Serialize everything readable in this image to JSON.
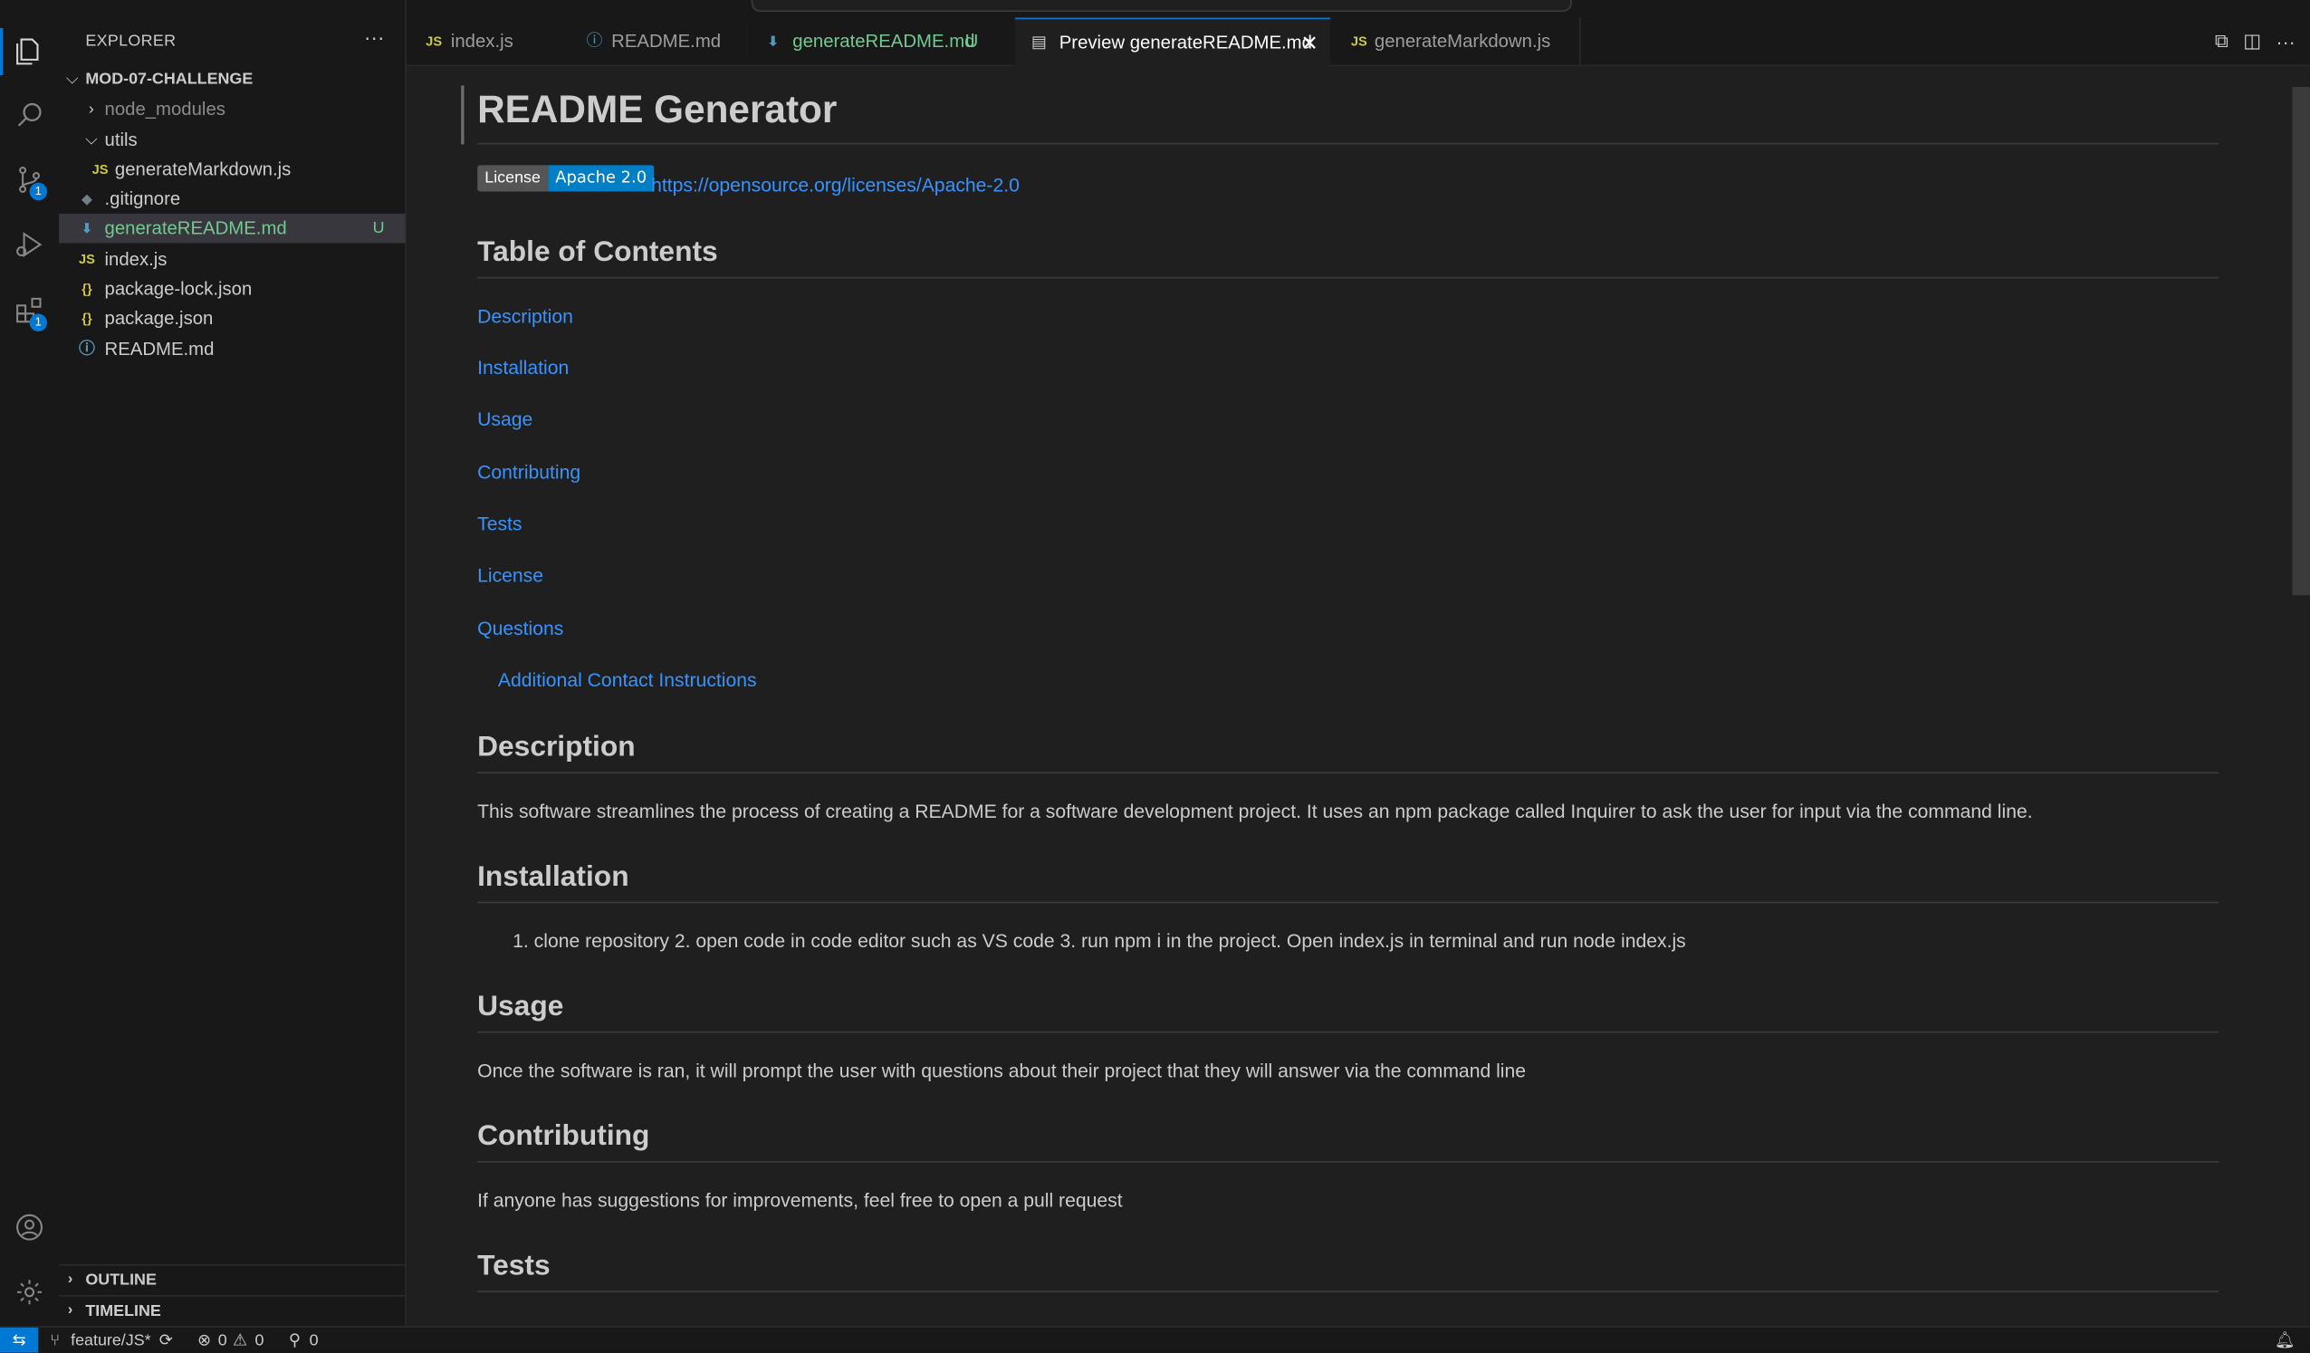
{
  "activity_bar": {
    "source_control_badge": "1",
    "extensions_badge": "1"
  },
  "sidebar": {
    "title": "EXPLORER",
    "folder": "MOD-07-CHALLENGE",
    "items": [
      {
        "label": "node_modules",
        "icon": "chevron-right-icon"
      },
      {
        "label": "utils",
        "icon": "chevron-down-icon"
      },
      {
        "label": "generateMarkdown.js",
        "icon": "js-file-icon"
      },
      {
        "label": ".gitignore",
        "icon": "git-file-icon"
      },
      {
        "label": "generateREADME.md",
        "icon": "markdown-file-icon",
        "status": "U"
      },
      {
        "label": "index.js",
        "icon": "js-file-icon"
      },
      {
        "label": "package-lock.json",
        "icon": "json-file-icon"
      },
      {
        "label": "package.json",
        "icon": "json-file-icon"
      },
      {
        "label": "README.md",
        "icon": "info-file-icon"
      }
    ],
    "outline": "OUTLINE",
    "timeline": "TIMELINE"
  },
  "tabs": [
    {
      "label": "index.js",
      "icon": "JS"
    },
    {
      "label": "README.md",
      "icon": "ⓘ"
    },
    {
      "label": "generateREADME.md",
      "status": "U"
    },
    {
      "label": "Preview generateREADME.md",
      "close": "✕"
    },
    {
      "label": "generateMarkdown.js",
      "icon": "JS"
    }
  ],
  "preview": {
    "title": "README Generator",
    "badge_left": "License",
    "badge_right": "Apache 2.0",
    "license_link": "https://opensource.org/licenses/Apache-2.0",
    "toc_heading": "Table of Contents",
    "toc": [
      "Description",
      "Installation",
      "Usage",
      "Contributing",
      "Tests",
      "License",
      "Questions"
    ],
    "toc_sub": "Additional Contact Instructions",
    "description_heading": "Description",
    "description_text": "This software streamlines the process of creating a README for a software development project. It uses an npm package called Inquirer to ask the user for input via the command line.",
    "installation_heading": "Installation",
    "installation_text": "1. clone repository 2. open code in code editor such as VS code 3. run npm i in the project. Open index.js in terminal and run node index.js",
    "usage_heading": "Usage",
    "usage_text": "Once the software is ran, it will prompt the user with questions about their project that they will answer via the command line",
    "contributing_heading": "Contributing",
    "contributing_text": "If anyone has suggestions for improvements, feel free to open a pull request",
    "tests_heading": "Tests"
  },
  "status_bar": {
    "branch": "feature/JS*",
    "errors": "0",
    "warnings": "0",
    "ports": "0"
  },
  "colors": {
    "accent": "#0078d4",
    "link": "#3794ff",
    "untracked": "#73c991"
  }
}
